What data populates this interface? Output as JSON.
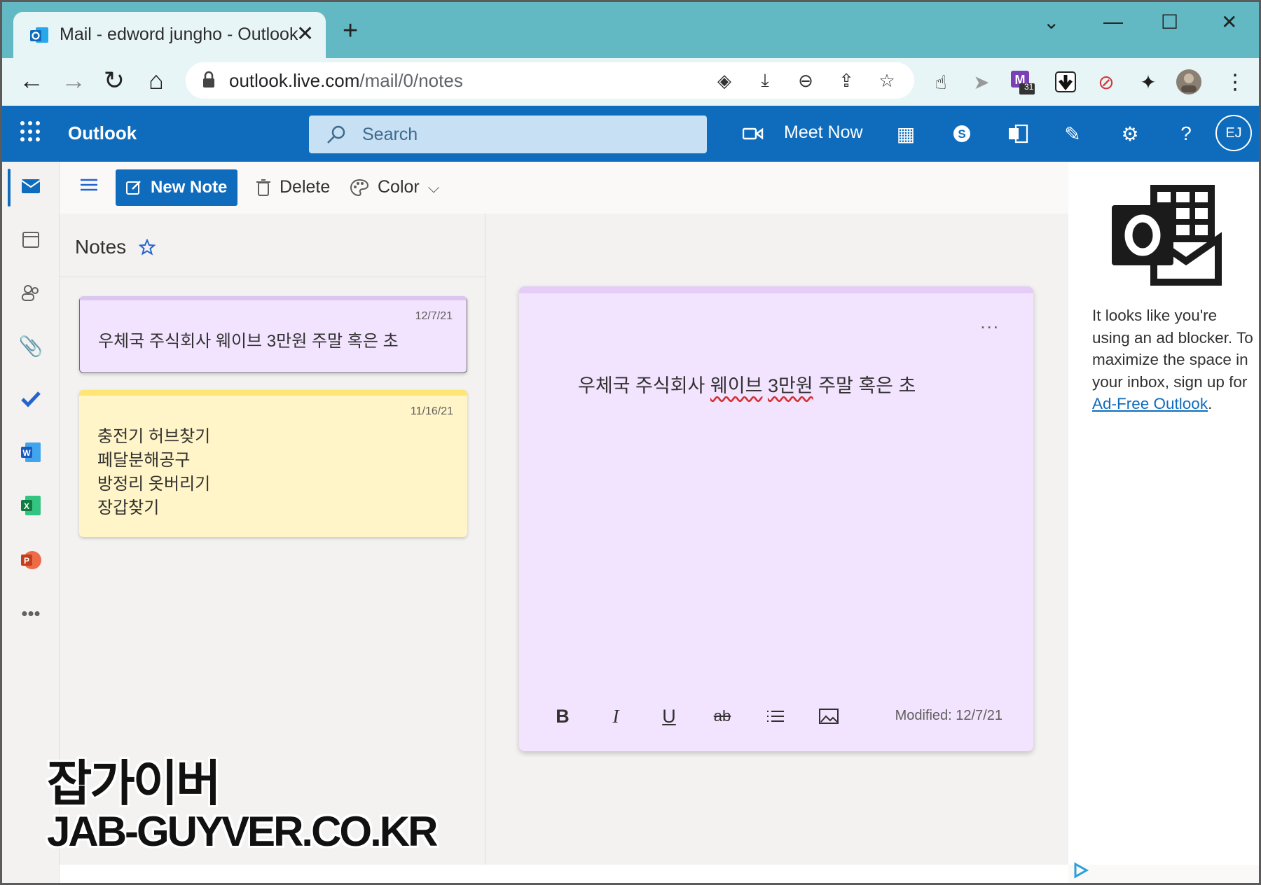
{
  "browser": {
    "tab_title": "Mail - edword jungho - Outlook",
    "url_host": "outlook.live.com",
    "url_path": "/mail/0/notes",
    "new_tab_label": "+",
    "extension_badge": "31"
  },
  "header": {
    "app_name": "Outlook",
    "search_placeholder": "Search",
    "meet_now_label": "Meet Now",
    "avatar_initials": "EJ",
    "help_label": "?"
  },
  "commands": {
    "new_note": "New Note",
    "delete": "Delete",
    "color": "Color"
  },
  "notes_list": {
    "title": "Notes",
    "notes": [
      {
        "date": "12/7/21",
        "text": "우체국 주식회사 웨이브 3만원 주말 혹은 초",
        "color": "#f2e4ff"
      },
      {
        "date": "11/16/21",
        "text": "충전기 허브찾기\n페달분해공구\n방정리 옷버리기\n장갑찾기",
        "color": "#fff5c8"
      }
    ]
  },
  "editor": {
    "more_label": "...",
    "text_parts": [
      "우체국 주식회사 ",
      "웨이브",
      " ",
      "3만원",
      " 주말 혹은 초"
    ],
    "modified": "Modified: 12/7/21",
    "format_buttons": [
      "B",
      "I",
      "U",
      "ab"
    ]
  },
  "ad": {
    "text": "It looks like you're using an ad blocker. To maximize the space in your inbox, sign up for ",
    "link": "Ad-Free Outlook",
    "tail": "."
  },
  "watermark": {
    "korean": "잡가이버",
    "domain": "JAB-GUYVER.CO.KR"
  },
  "colors": {
    "outlook_blue": "#0f6cbd",
    "chrome_teal": "#63b9c3",
    "note_purple": "#f2e4ff",
    "note_yellow": "#fff5c8"
  }
}
